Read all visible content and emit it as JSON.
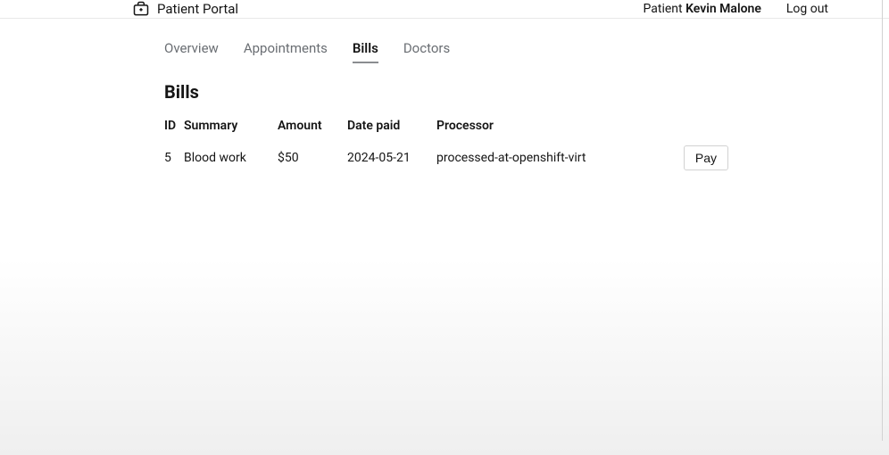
{
  "header": {
    "app_title": "Patient Portal",
    "patient_prefix": "Patient ",
    "patient_name": "Kevin Malone",
    "logout_label": "Log out"
  },
  "tabs": {
    "overview": "Overview",
    "appointments": "Appointments",
    "bills": "Bills",
    "doctors": "Doctors"
  },
  "page": {
    "title": "Bills"
  },
  "table": {
    "headers": {
      "id": "ID",
      "summary": "Summary",
      "amount": "Amount",
      "date_paid": "Date paid",
      "processor": "Processor"
    },
    "rows": [
      {
        "id": "5",
        "summary": "Blood work",
        "amount": "$50",
        "date_paid": "2024-05-21",
        "processor": "processed-at-openshift-virt",
        "action_label": "Pay"
      }
    ]
  }
}
